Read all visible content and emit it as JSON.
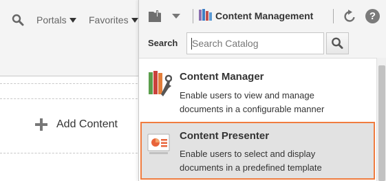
{
  "nav": {
    "search_icon": "magnifier-icon",
    "portals_label": "Portals",
    "favorites_label": "Favorites"
  },
  "page": {
    "add_content_label": "Add Content"
  },
  "catalog": {
    "toolbar": {
      "title": "Content Management",
      "add_icon": "folder-add-icon",
      "refresh_icon": "refresh-icon",
      "help_label": "?"
    },
    "search": {
      "label": "Search",
      "placeholder": "Search Catalog",
      "value": ""
    },
    "items": [
      {
        "title": "Content Manager",
        "desc_lines": [
          "Enable users to view and manage",
          "documents in a configurable manner"
        ],
        "icon": "content-manager-icon"
      },
      {
        "title": "Content Presenter",
        "desc_lines": [
          "Enable users to select and display",
          "documents in a predefined template"
        ],
        "icon": "content-presenter-icon",
        "selected": true
      }
    ]
  },
  "colors": {
    "selection_border": "#f07c3f",
    "selected_bg": "#e2e2e2",
    "toolbar_bg": "#f4f4f4"
  }
}
